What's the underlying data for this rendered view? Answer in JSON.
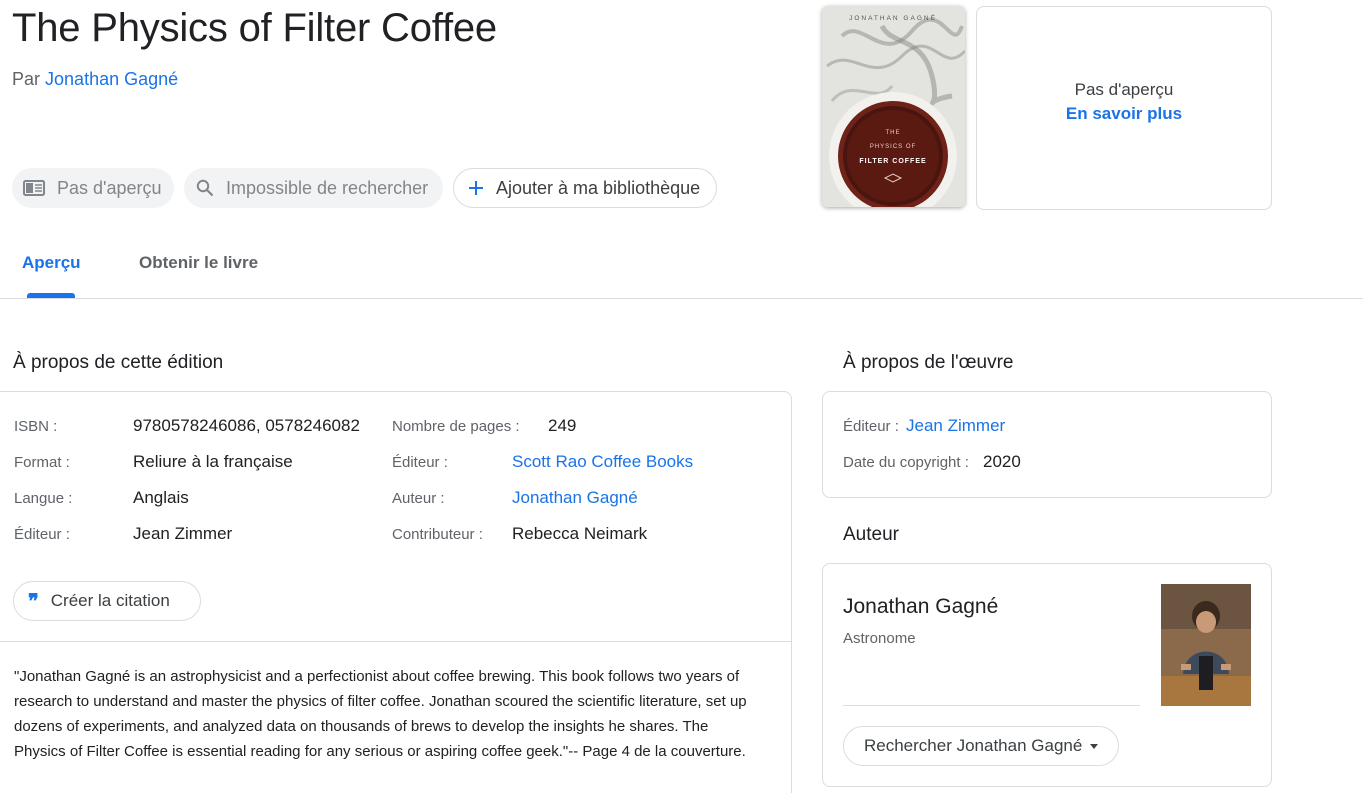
{
  "book": {
    "title": "The Physics of Filter Coffee",
    "by_prefix": "Par",
    "author": "Jonathan Gagné"
  },
  "actions": {
    "no_preview": "Pas d'aperçu",
    "no_search": "Impossible de rechercher",
    "add_library": "Ajouter à ma bibliothèque"
  },
  "cover": {
    "author_text": "JONATHAN GAGNÉ",
    "title_line1": "THE",
    "title_line2": "PHYSICS OF",
    "title_line3": "FILTER COFFEE"
  },
  "preview_panel": {
    "text": "Pas d'aperçu",
    "link": "En savoir plus"
  },
  "tabs": [
    {
      "label": "Aperçu",
      "active": true
    },
    {
      "label": "Obtenir le livre",
      "active": false
    }
  ],
  "edition": {
    "heading": "À propos de cette édition",
    "left": [
      {
        "label": "ISBN :",
        "value": "9780578246086, 0578246082"
      },
      {
        "label": "Format :",
        "value": "Reliure à la française"
      },
      {
        "label": "Langue :",
        "value": "Anglais"
      },
      {
        "label": "Éditeur :",
        "value": "Jean Zimmer"
      }
    ],
    "right": [
      {
        "label": "Nombre de pages :",
        "value": "249"
      },
      {
        "label": "Éditeur :",
        "value": "Scott Rao Coffee Books"
      },
      {
        "label": "Auteur :",
        "value": "Jonathan Gagné"
      },
      {
        "label": "Contributeur :",
        "value": "Rebecca Neimark"
      }
    ],
    "cite_label": "Créer la citation",
    "description": "\"Jonathan Gagné is an astrophysicist and a perfectionist about coffee brewing. This book follows two years of research to understand and master the physics of filter coffee. Jonathan scoured the scientific literature, set up dozens of experiments, and analyzed data on thousands of brews to develop the insights he shares. The Physics of Filter Coffee is essential reading for any serious or aspiring coffee geek.\"-- Page 4 de la couverture."
  },
  "work": {
    "heading": "À propos de l'œuvre",
    "editor_label": "Éditeur :",
    "editor_value": "Jean Zimmer",
    "copyright_label": "Date du copyright :",
    "copyright_value": "2020"
  },
  "author_card": {
    "heading": "Auteur",
    "name": "Jonathan Gagné",
    "role": "Astronome",
    "search_label": "Rechercher Jonathan Gagné"
  },
  "colors": {
    "accent": "#1a73e8",
    "text": "#202124",
    "muted": "#5f6368",
    "border": "#dadce0"
  }
}
